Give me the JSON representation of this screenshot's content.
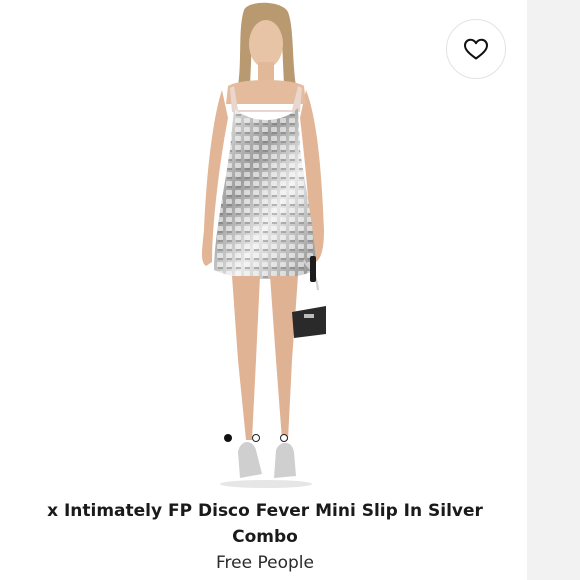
{
  "product": {
    "title": "x Intimately FP Disco Fever Mini Slip In Silver Combo",
    "brand": "Free People"
  },
  "icons": {
    "wishlist": "heart-icon"
  },
  "carousel": {
    "count": 3,
    "active_index": 0
  },
  "colors": {
    "background": "#ffffff",
    "side_panel": "#f2f2f2",
    "text": "#1a1a1a",
    "dress": "#c9c9c9"
  }
}
